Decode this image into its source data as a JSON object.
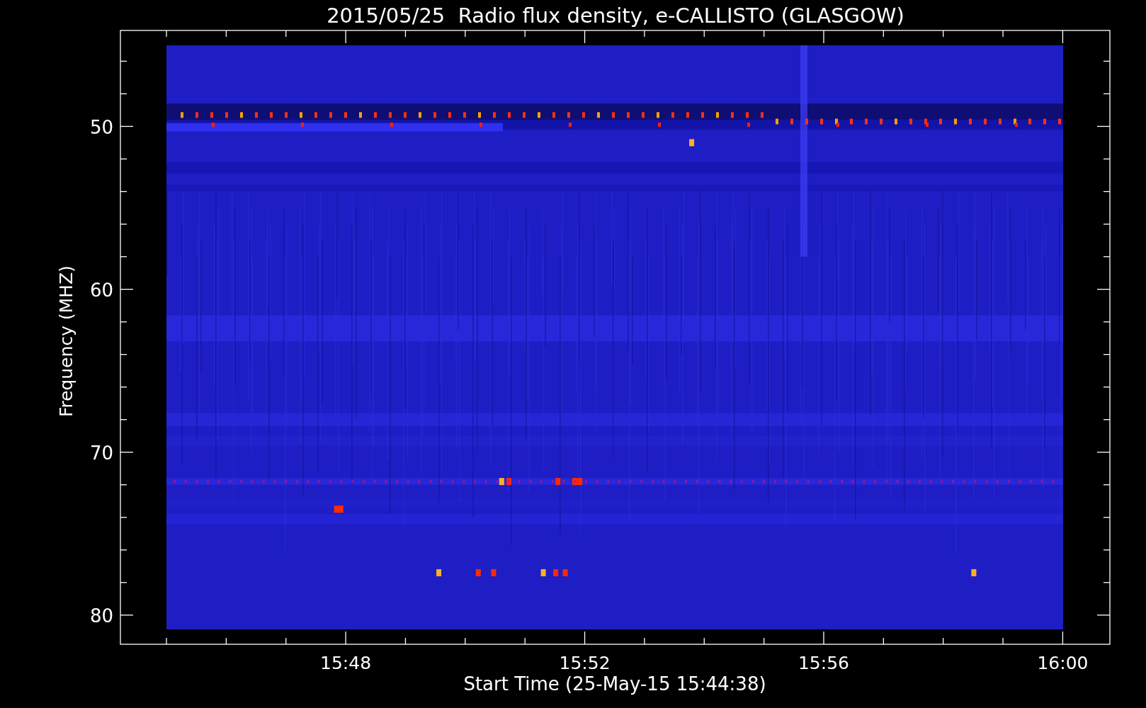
{
  "title": "2015/05/25  Radio flux density, e-CALLISTO (GLASGOW)",
  "ylabel": "Frequency (MHZ)",
  "xlabel": "Start Time (25-May-15 15:44:38)",
  "yticks": [
    "50",
    "60",
    "70",
    "80"
  ],
  "xticks": [
    "15:48",
    "15:52",
    "15:56",
    "16:00"
  ]
}
